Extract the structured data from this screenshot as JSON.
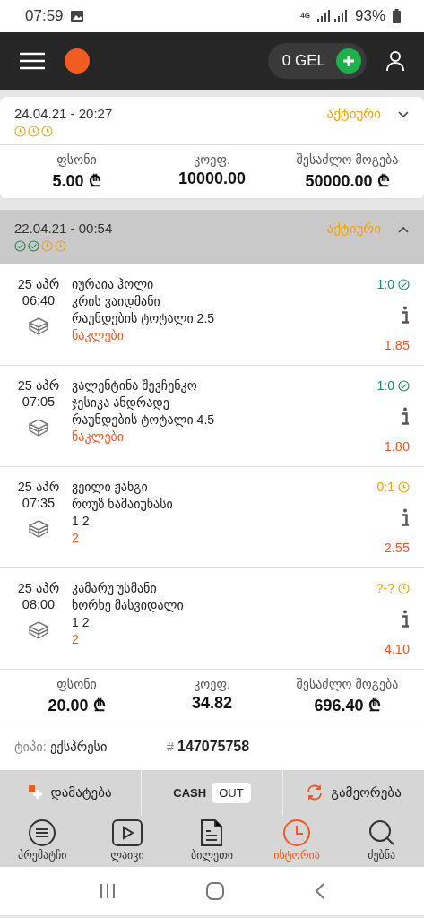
{
  "status_bar": {
    "time": "07:59",
    "network": "4G",
    "battery": "93%"
  },
  "header": {
    "balance": "0 GEL"
  },
  "tickets": [
    {
      "datetime": "24.04.21 - 20:27",
      "status": "აქტიური",
      "expanded": false,
      "leg_marks": [
        {
          "won": false
        },
        {
          "won": false
        },
        {
          "won": false
        }
      ],
      "totals": [
        {
          "label": "ფსონი",
          "value": "5.00 ₾"
        },
        {
          "label": "კოეფ.",
          "value": "10000.00"
        },
        {
          "label": "შესაძლო მოგება",
          "value": "50000.00 ₾"
        }
      ]
    },
    {
      "datetime": "22.04.21 - 00:54",
      "status": "აქტიური",
      "expanded": true,
      "leg_marks": [
        {
          "won": true
        },
        {
          "won": true
        },
        {
          "won": false
        },
        {
          "won": false
        }
      ],
      "legs": [
        {
          "date": "25 აპრ",
          "time": "06:40",
          "team_1": "იურაია ჰოლი",
          "team_2": "კრის ვაიდმანი",
          "market": "რაუნდების ტოტალი 2.5",
          "pick": "ნაკლები",
          "score": "1:0",
          "won": true,
          "odds": "1.85"
        },
        {
          "date": "25 აპრ",
          "time": "07:05",
          "team_1": "ვალენტინა შევჩენკო",
          "team_2": "ჯესიკა ანდრადე",
          "market": "რაუნდების ტოტალი 4.5",
          "pick": "ნაკლები",
          "score": "1:0",
          "won": true,
          "odds": "1.80"
        },
        {
          "date": "25 აპრ",
          "time": "07:35",
          "team_1": "ვეილი ჟანგი",
          "team_2": "როუზ ნამაიუნასი",
          "market": "1 2",
          "pick": "2",
          "score": "0:1",
          "won": false,
          "odds": "2.55"
        },
        {
          "date": "25 აპრ",
          "time": "08:00",
          "team_1": "კამარუ უსმანი",
          "team_2": "ხორხე მასვიდალი",
          "market": "1 2",
          "pick": "2",
          "score": "?-?",
          "won": false,
          "odds": "4.10"
        }
      ],
      "totals": [
        {
          "label": "ფსონი",
          "value": "20.00 ₾"
        },
        {
          "label": "კოეფ.",
          "value": "34.82"
        },
        {
          "label": "შესაძლო მოგება",
          "value": "696.40 ₾"
        }
      ],
      "type_label": "ტიპი:",
      "type_value": "ექსპრესი",
      "number_sign": "#",
      "number": "147075758"
    }
  ],
  "actions": {
    "add": "დამატება",
    "cash": "CASH",
    "out": "OUT",
    "repeat": "გამეორება"
  },
  "nav": [
    {
      "kind": "prematch",
      "label": "პრემატჩი",
      "selected": false
    },
    {
      "kind": "live",
      "label": "ლაივი",
      "selected": false
    },
    {
      "kind": "ticket",
      "label": "ბილეთი",
      "selected": false
    },
    {
      "kind": "history",
      "label": "ისტორია",
      "selected": true
    },
    {
      "kind": "search",
      "label": "ძებნა",
      "selected": false
    }
  ]
}
